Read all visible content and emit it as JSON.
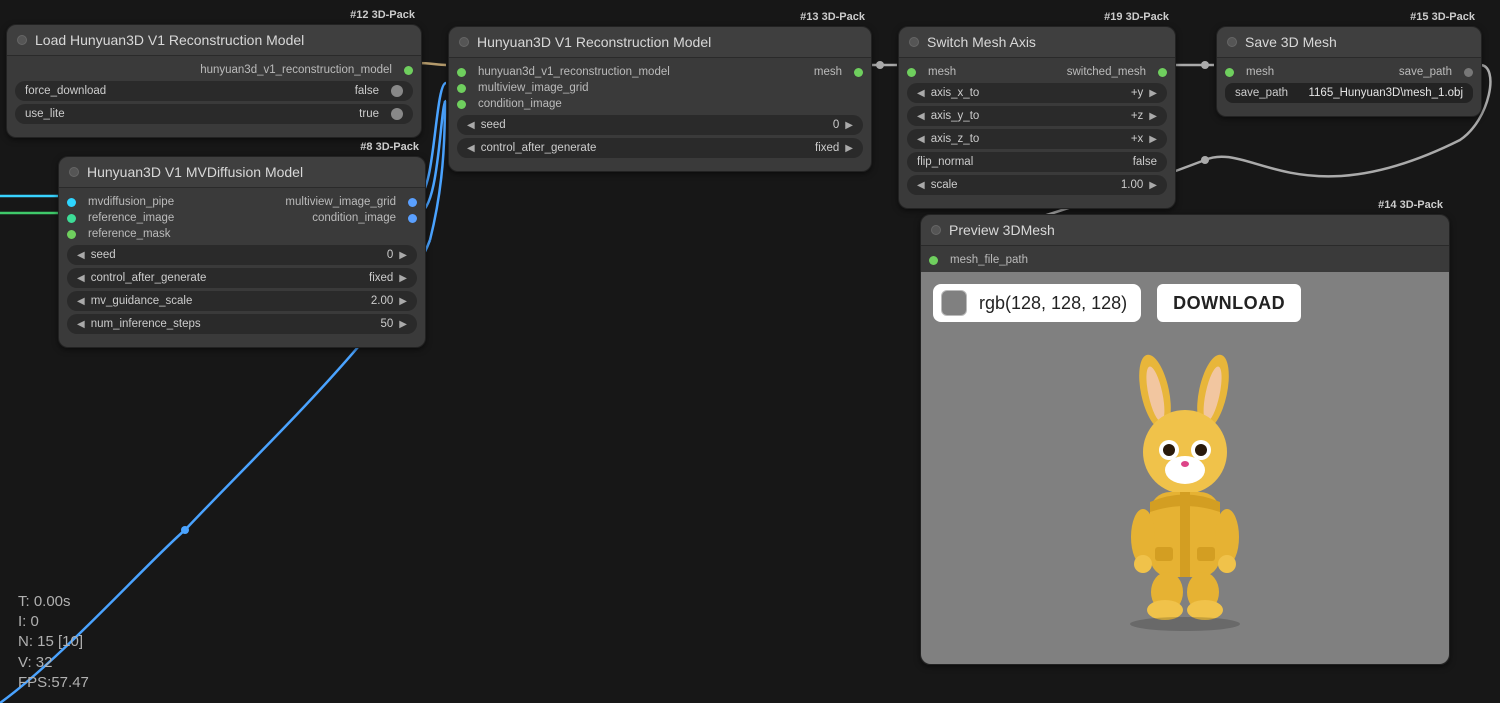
{
  "stats": {
    "t": "T: 0.00s",
    "i": "I: 0",
    "n": "N: 15 [10]",
    "v": "V: 32",
    "fps": "FPS:57.47"
  },
  "nodes": {
    "load_recon": {
      "badge": "#12 3D-Pack",
      "title": "Load Hunyuan3D V1 Reconstruction Model",
      "outputs": {
        "model": "hunyuan3d_v1_reconstruction_model"
      },
      "widgets": {
        "force_download": {
          "label": "force_download",
          "value": "false"
        },
        "use_lite": {
          "label": "use_lite",
          "value": "true"
        }
      }
    },
    "mvdiff": {
      "badge": "#8 3D-Pack",
      "title": "Hunyuan3D V1 MVDiffusion Model",
      "inputs": {
        "pipe": "mvdiffusion_pipe",
        "ref_img": "reference_image",
        "ref_mask": "reference_mask"
      },
      "outputs": {
        "grid": "multiview_image_grid",
        "cond": "condition_image"
      },
      "widgets": {
        "seed": {
          "label": "seed",
          "value": "0"
        },
        "control": {
          "label": "control_after_generate",
          "value": "fixed"
        },
        "guidance": {
          "label": "mv_guidance_scale",
          "value": "2.00"
        },
        "steps": {
          "label": "num_inference_steps",
          "value": "50"
        }
      }
    },
    "recon": {
      "badge": "#13 3D-Pack",
      "title": "Hunyuan3D V1 Reconstruction Model",
      "inputs": {
        "model": "hunyuan3d_v1_reconstruction_model",
        "grid": "multiview_image_grid",
        "cond": "condition_image"
      },
      "outputs": {
        "mesh": "mesh"
      },
      "widgets": {
        "seed": {
          "label": "seed",
          "value": "0"
        },
        "control": {
          "label": "control_after_generate",
          "value": "fixed"
        }
      }
    },
    "switch_axis": {
      "badge": "#19 3D-Pack",
      "title": "Switch Mesh Axis",
      "inputs": {
        "mesh": "mesh"
      },
      "outputs": {
        "switched": "switched_mesh"
      },
      "widgets": {
        "x": {
          "label": "axis_x_to",
          "value": "+y"
        },
        "y": {
          "label": "axis_y_to",
          "value": "+z"
        },
        "z": {
          "label": "axis_z_to",
          "value": "+x"
        },
        "flip": {
          "label": "flip_normal",
          "value": "false"
        },
        "scale": {
          "label": "scale",
          "value": "1.00"
        }
      }
    },
    "save_mesh": {
      "badge": "#15 3D-Pack",
      "title": "Save 3D Mesh",
      "inputs": {
        "mesh": "mesh"
      },
      "outputs": {
        "path": "save_path"
      },
      "widgets": {
        "save_path": {
          "label": "save_path",
          "value": "1165_Hunyuan3D\\mesh_1.obj"
        }
      }
    },
    "preview": {
      "badge": "#14 3D-Pack",
      "title": "Preview 3DMesh",
      "inputs": {
        "path": "mesh_file_path"
      },
      "color_label": "rgb(128, 128, 128)",
      "download": "DOWNLOAD"
    }
  }
}
